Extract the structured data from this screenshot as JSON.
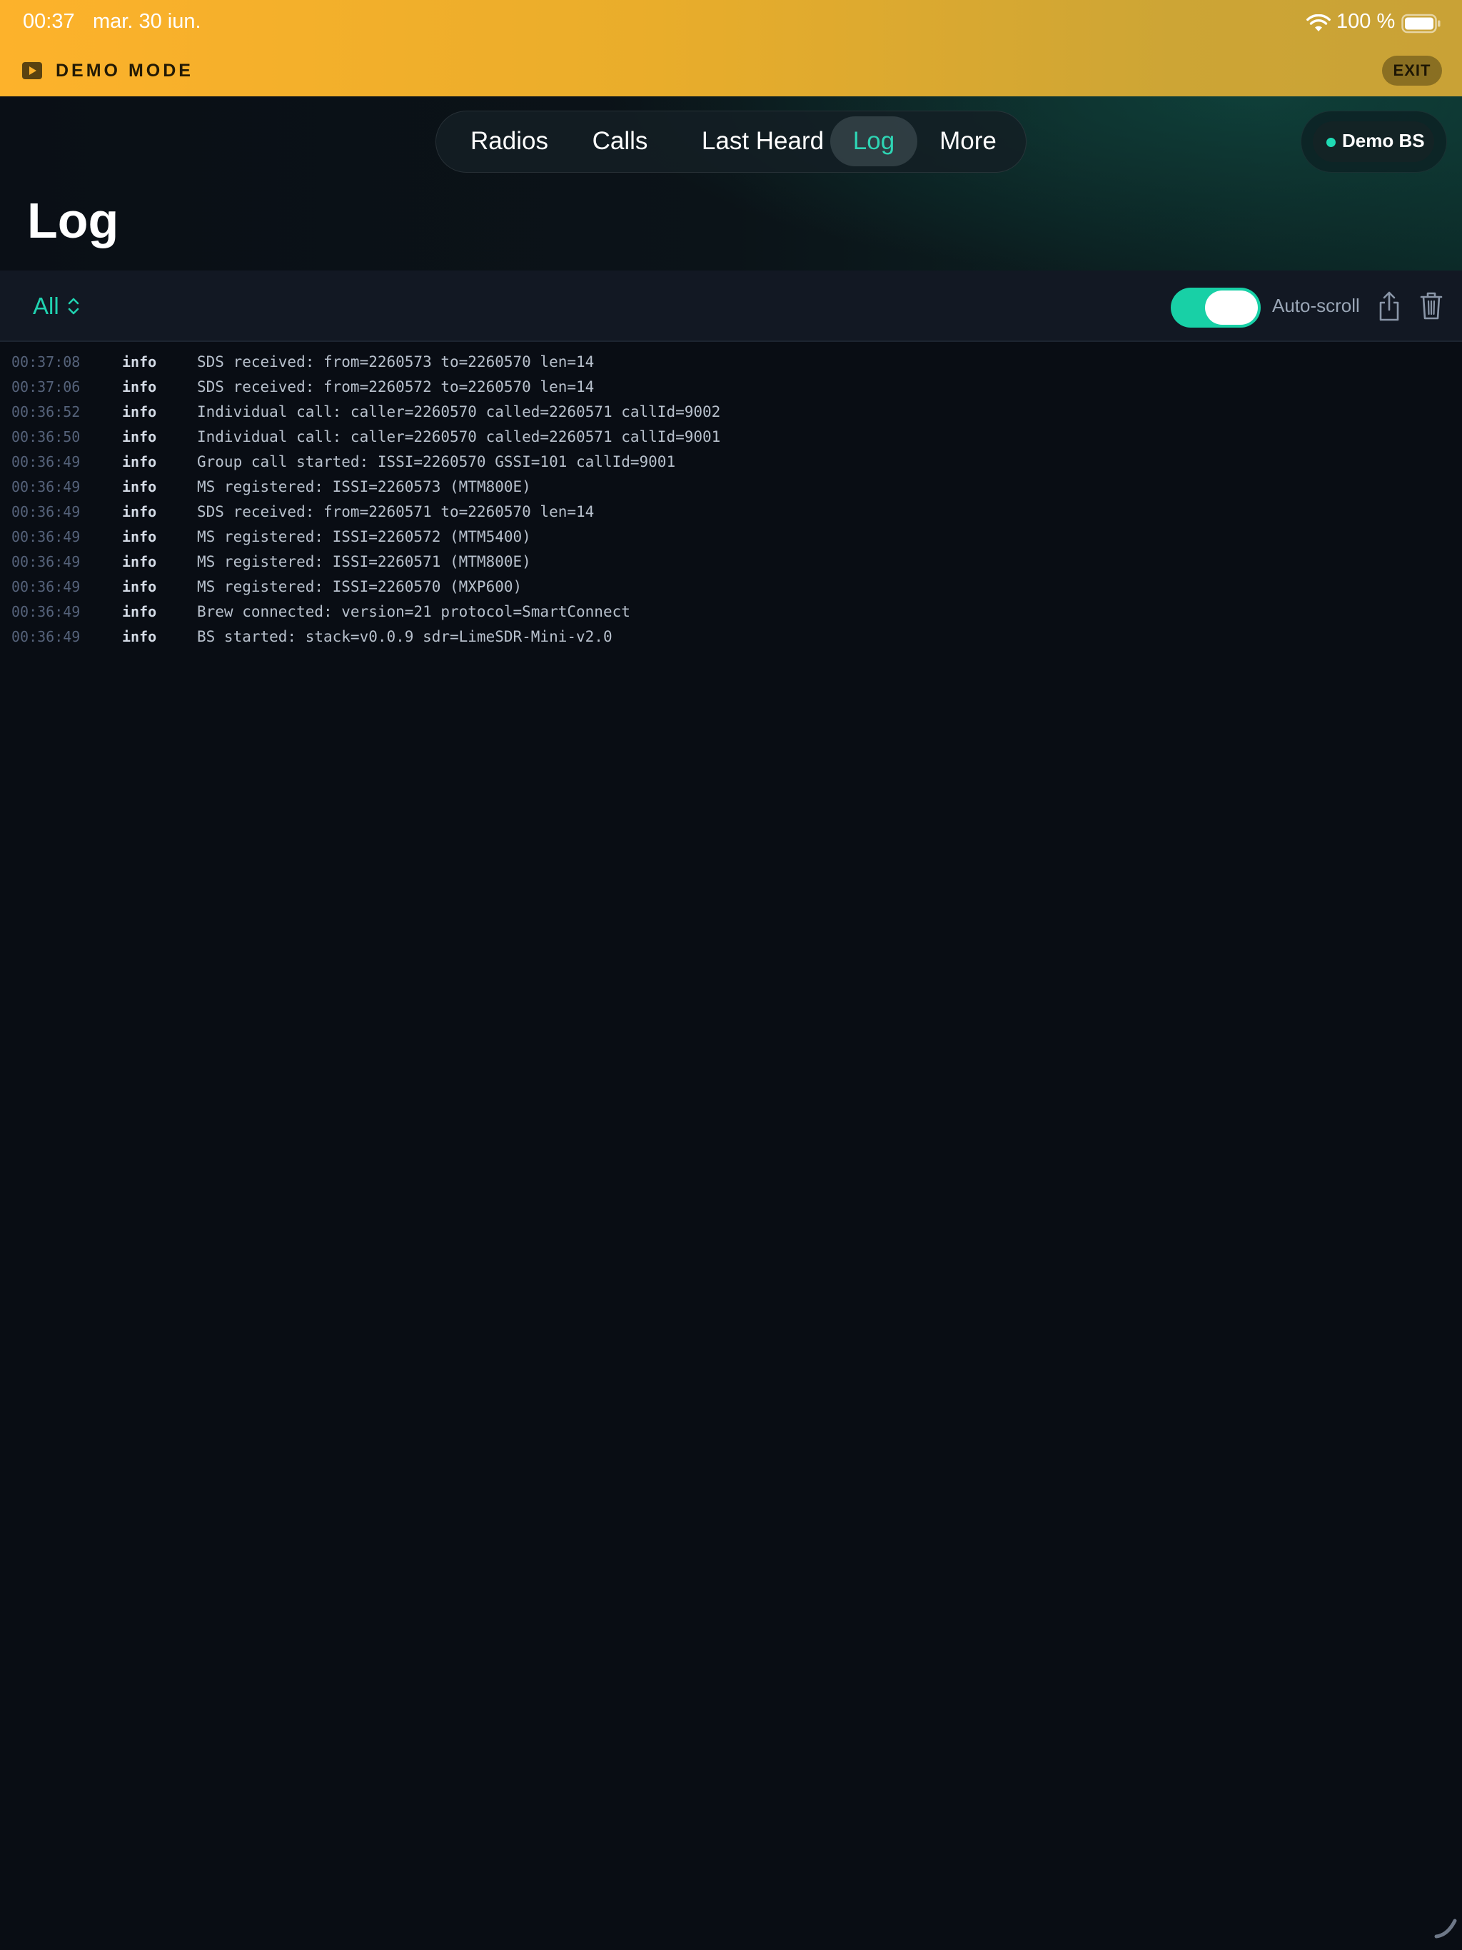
{
  "status_bar": {
    "time": "00:37",
    "date": "mar. 30 iun.",
    "battery": "100 %"
  },
  "demo_banner": {
    "label": "DEMO MODE",
    "exit_label": "EXIT"
  },
  "nav": {
    "tabs": [
      {
        "label": "Radios",
        "active": false
      },
      {
        "label": "Calls",
        "active": false
      },
      {
        "label": "Last Heard",
        "active": false
      },
      {
        "label": "Log",
        "active": true
      },
      {
        "label": "More",
        "active": false
      }
    ],
    "base_station": {
      "label": "Demo BS",
      "status": "online"
    }
  },
  "page": {
    "title": "Log"
  },
  "toolbar": {
    "filter": "All",
    "autoscroll_label": "Auto-scroll",
    "autoscroll_on": true
  },
  "log": {
    "entries": [
      {
        "time": "00:37:08",
        "level": "info",
        "message": "SDS received: from=2260573 to=2260570 len=14"
      },
      {
        "time": "00:37:06",
        "level": "info",
        "message": "SDS received: from=2260572 to=2260570 len=14"
      },
      {
        "time": "00:36:52",
        "level": "info",
        "message": "Individual call: caller=2260570 called=2260571 callId=9002"
      },
      {
        "time": "00:36:50",
        "level": "info",
        "message": "Individual call: caller=2260570 called=2260571 callId=9001"
      },
      {
        "time": "00:36:49",
        "level": "info",
        "message": "Group call started: ISSI=2260570 GSSI=101 callId=9001"
      },
      {
        "time": "00:36:49",
        "level": "info",
        "message": "MS registered: ISSI=2260573 (MTM800E)"
      },
      {
        "time": "00:36:49",
        "level": "info",
        "message": "SDS received: from=2260571 to=2260570 len=14"
      },
      {
        "time": "00:36:49",
        "level": "info",
        "message": "MS registered: ISSI=2260572 (MTM5400)"
      },
      {
        "time": "00:36:49",
        "level": "info",
        "message": "MS registered: ISSI=2260571 (MTM800E)"
      },
      {
        "time": "00:36:49",
        "level": "info",
        "message": "MS registered: ISSI=2260570 (MXP600)"
      },
      {
        "time": "00:36:49",
        "level": "info",
        "message": "Brew connected: version=21 protocol=SmartConnect"
      },
      {
        "time": "00:36:49",
        "level": "info",
        "message": "BS started: stack=v0.0.9 sdr=LimeSDR-Mini-v2.0"
      }
    ]
  },
  "colors": {
    "accent": "#20d2b0",
    "banner": "#fdb22b",
    "background": "#090d14"
  }
}
